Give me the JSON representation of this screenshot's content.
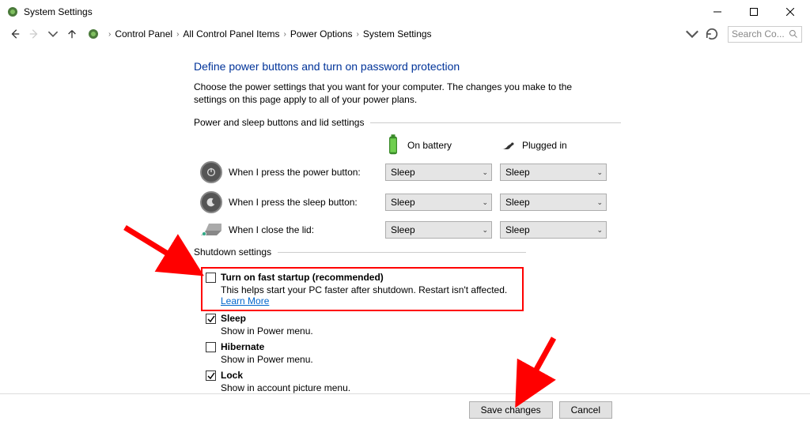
{
  "window": {
    "title": "System Settings"
  },
  "breadcrumb": [
    "Control Panel",
    "All Control Panel Items",
    "Power Options",
    "System Settings"
  ],
  "search": {
    "placeholder": "Search Co..."
  },
  "heading": "Define power buttons and turn on password protection",
  "description": "Choose the power settings that you want for your computer. The changes you make to the settings on this page apply to all of your power plans.",
  "section1_label": "Power and sleep buttons and lid settings",
  "columns": {
    "battery": "On battery",
    "plugged": "Plugged in"
  },
  "rows": {
    "power": {
      "label": "When I press the power button:",
      "battery": "Sleep",
      "plugged": "Sleep"
    },
    "sleep": {
      "label": "When I press the sleep button:",
      "battery": "Sleep",
      "plugged": "Sleep"
    },
    "lid": {
      "label": "When I close the lid:",
      "battery": "Sleep",
      "plugged": "Sleep"
    }
  },
  "section2_label": "Shutdown settings",
  "shutdown": {
    "fast": {
      "label": "Turn on fast startup (recommended)",
      "desc": "This helps start your PC faster after shutdown. Restart isn't affected. ",
      "link": "Learn More"
    },
    "sleep": {
      "label": "Sleep",
      "desc": "Show in Power menu."
    },
    "hib": {
      "label": "Hibernate",
      "desc": "Show in Power menu."
    },
    "lock": {
      "label": "Lock",
      "desc": "Show in account picture menu."
    }
  },
  "buttons": {
    "save": "Save changes",
    "cancel": "Cancel"
  }
}
